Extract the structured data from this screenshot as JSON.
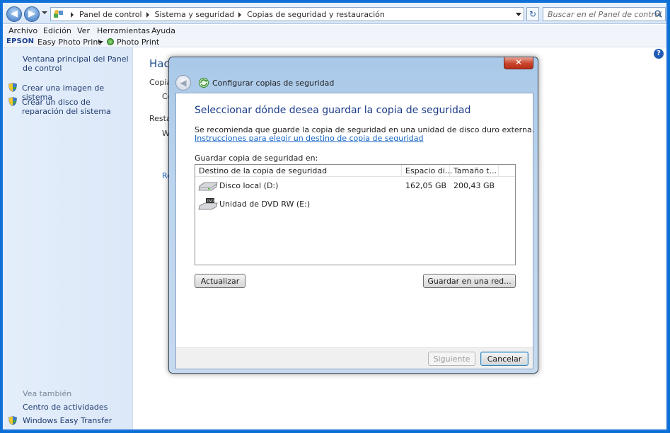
{
  "window": {
    "nav": {
      "back_label": "Atrás",
      "forward_label": "Adelante",
      "breadcrumbs": [
        "Panel de control",
        "Sistema y seguridad",
        "Copias de seguridad y restauración"
      ],
      "search_placeholder": "Buscar en el Panel de control"
    },
    "menu": [
      "Archivo",
      "Edición",
      "Ver",
      "Herramientas",
      "Ayuda"
    ],
    "epson_toolbar": {
      "brand": "EPSON",
      "easy_photo_print": "Easy Photo Print",
      "photo_print": "Photo Print"
    },
    "sidebar": {
      "links": [
        {
          "label": "Ventana principal del Panel de control",
          "icon": "none"
        },
        {
          "label": "Crear una imagen de sistema",
          "icon": "shield-icon"
        },
        {
          "label": "Crear un disco de reparación del sistema",
          "icon": "shield-icon"
        }
      ],
      "see_also_title": "Vea también",
      "see_also": [
        {
          "label": "Centro de actividades",
          "icon": "none"
        },
        {
          "label": "Windows Easy Transfer",
          "icon": "shield-icon"
        }
      ]
    },
    "background": {
      "title": "Hace",
      "line1": "Copia",
      "line2": "Co",
      "line3": "Restau",
      "line4": "Wi",
      "line5": "Re"
    }
  },
  "dialog": {
    "close_label": "✕",
    "title": "Configurar copias de seguridad",
    "heading": "Seleccionar dónde desea guardar la copia de seguridad",
    "description": "Se recomienda que guarde la copia de seguridad en una unidad de disco duro externa.",
    "link": "Instrucciones para elegir un destino de copia de seguridad",
    "save_label": "Guardar copia de seguridad en:",
    "columns": [
      "Destino de la copia de seguridad",
      "Espacio di...",
      "Tamaño t..."
    ],
    "rows": [
      {
        "name": "Disco local (D:)",
        "free": "162,05 GB",
        "total": "200,43 GB",
        "icon": "hard-drive-icon"
      },
      {
        "name": "Unidad de DVD RW (E:)",
        "free": "",
        "total": "",
        "icon": "dvd-drive-icon"
      }
    ],
    "buttons": {
      "refresh": "Actualizar",
      "network": "Guardar en una red...",
      "next": "Siguiente",
      "cancel": "Cancelar"
    },
    "colors": {
      "heading": "#1b3c87",
      "link": "#1565c7"
    }
  }
}
